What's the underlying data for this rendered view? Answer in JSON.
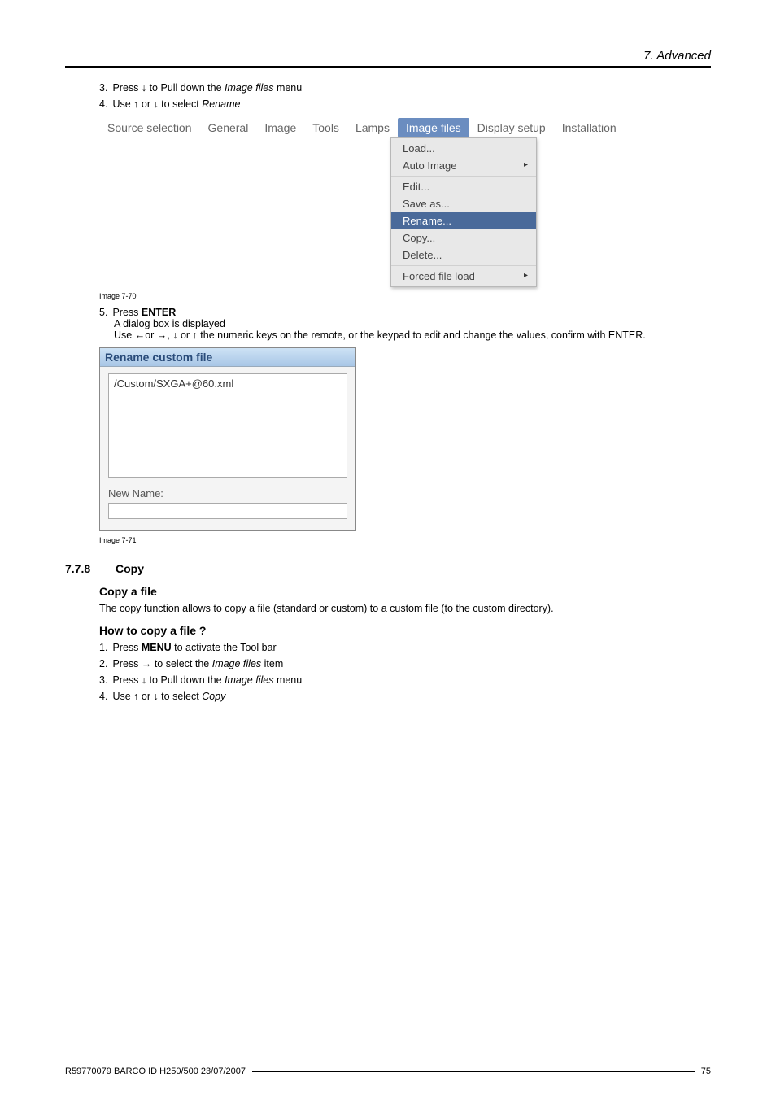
{
  "header": {
    "title": "7.  Advanced"
  },
  "steps_top": [
    {
      "num": "3.",
      "pre": "Press ↓ to Pull down the ",
      "italic": "Image files",
      "post": " menu"
    },
    {
      "num": "4.",
      "pre": "Use ↑ or ↓ to select ",
      "italic": "Rename",
      "post": ""
    }
  ],
  "menubar": {
    "tabs": [
      {
        "label": "Source selection",
        "active": false
      },
      {
        "label": "General",
        "active": false
      },
      {
        "label": "Image",
        "active": false
      },
      {
        "label": "Tools",
        "active": false
      },
      {
        "label": "Lamps",
        "active": false
      },
      {
        "label": "Image files",
        "active": true
      },
      {
        "label": "Display setup",
        "active": false
      },
      {
        "label": "Installation",
        "active": false
      }
    ]
  },
  "dropdown": {
    "groups": [
      {
        "items": [
          {
            "label": "Load...",
            "selected": false,
            "submenu": false
          },
          {
            "label": "Auto Image",
            "selected": false,
            "submenu": true
          }
        ]
      },
      {
        "items": [
          {
            "label": "Edit...",
            "selected": false,
            "submenu": false
          },
          {
            "label": "Save as...",
            "selected": false,
            "submenu": false
          },
          {
            "label": "Rename...",
            "selected": true,
            "submenu": false
          },
          {
            "label": "Copy...",
            "selected": false,
            "submenu": false
          },
          {
            "label": "Delete...",
            "selected": false,
            "submenu": false
          }
        ]
      },
      {
        "items": [
          {
            "label": "Forced file load",
            "selected": false,
            "submenu": true
          }
        ]
      }
    ]
  },
  "caption1": "Image 7-70",
  "step5": {
    "num": "5.",
    "pre": "Press ",
    "bold": "ENTER",
    "line2": "A dialog box is displayed",
    "line3": "Use ←or →, ↓ or ↑ the numeric keys on the remote, or the keypad to edit and change the values, confirm with ENTER."
  },
  "dialog": {
    "title": "Rename custom file",
    "file": "/Custom/SXGA+@60.xml",
    "newname_label": "New Name:",
    "newname_value": ""
  },
  "caption2": "Image 7-71",
  "section": {
    "number": "7.7.8",
    "title": "Copy",
    "sub1": "Copy a file",
    "sub1_text": "The copy function allows to copy a file (standard or custom) to a custom file (to the custom directory).",
    "sub2": "How to copy a file ?"
  },
  "steps_bottom": [
    {
      "num": "1.",
      "pre": "Press ",
      "bold": "MENU",
      "post": " to activate the Tool bar"
    },
    {
      "num": "2.",
      "pre": "Press → to select the ",
      "italic": "Image files",
      "post": " item"
    },
    {
      "num": "3.",
      "pre": "Press ↓ to Pull down the ",
      "italic": "Image files",
      "post": " menu"
    },
    {
      "num": "4.",
      "pre": "Use ↑ or ↓ to select ",
      "italic": "Copy",
      "post": ""
    }
  ],
  "footer": {
    "text": "R59770079  BARCO ID H250/500  23/07/2007",
    "page": "75"
  }
}
